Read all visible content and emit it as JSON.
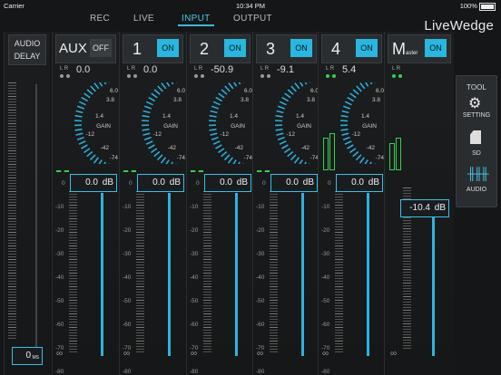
{
  "status": {
    "carrier": "Carrier",
    "time": "10:34 PM",
    "battery": "100%"
  },
  "nav": {
    "tabs": [
      "REC",
      "LIVE",
      "INPUT",
      "OUTPUT"
    ],
    "active": "INPUT",
    "brand": "LiveWedge"
  },
  "delay": {
    "title1": "AUDIO",
    "title2": "DELAY",
    "value": "0",
    "unit": "MS"
  },
  "scale_labels": [
    "0",
    "-10",
    "-20",
    "-30",
    "-40",
    "-50",
    "-60",
    "-70",
    "-80"
  ],
  "gain_labels": [
    "6.0",
    "3.8",
    "1.4",
    "GAIN",
    "-12",
    "-42",
    "-74"
  ],
  "infinity": "∞",
  "channels": [
    {
      "name": "AUX",
      "button": "OFF",
      "on": false,
      "peak": "0.0",
      "fader": "0.0",
      "unit": "dB",
      "level_left": 0,
      "level_right": 0,
      "leds": [
        "grey",
        "grey"
      ]
    },
    {
      "name": "1",
      "button": "ON",
      "on": true,
      "peak": "0.0",
      "fader": "0.0",
      "unit": "dB",
      "level_left": 0,
      "level_right": 0,
      "leds": [
        "grey",
        "grey"
      ]
    },
    {
      "name": "2",
      "button": "ON",
      "on": true,
      "peak": "-50.9",
      "fader": "0.0",
      "unit": "dB",
      "level_left": 0,
      "level_right": 0,
      "leds": [
        "grey",
        "grey"
      ]
    },
    {
      "name": "3",
      "button": "ON",
      "on": true,
      "peak": "-9.1",
      "fader": "0.0",
      "unit": "dB",
      "level_left": 0,
      "level_right": 0,
      "leds": [
        "grey",
        "grey"
      ]
    },
    {
      "name": "4",
      "button": "ON",
      "on": true,
      "peak": "5.4",
      "fader": "0.0",
      "unit": "dB",
      "level_left": 0.72,
      "level_right": 0.72,
      "leds": [
        "green",
        "green"
      ]
    }
  ],
  "master": {
    "name_big": "M",
    "name_small": "aster",
    "button": "ON",
    "fader": "-10.4",
    "unit": "dB",
    "level_left": 0.7,
    "level_right": 0.7,
    "leds": [
      "green",
      "green"
    ]
  },
  "lr_label": "L R",
  "tool": {
    "title": "TOOL",
    "setting": "SETTING",
    "sd": "SD",
    "audio": "AUDIO"
  },
  "colors": {
    "accent": "#29b6df",
    "meter": "#35d14e"
  }
}
